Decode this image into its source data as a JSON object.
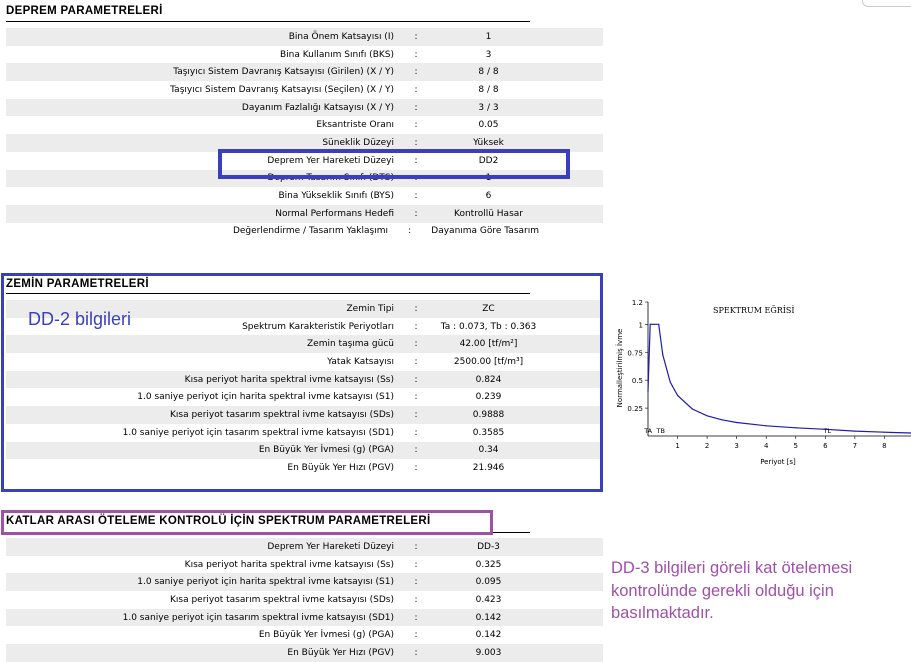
{
  "deprem": {
    "title": "DEPREM PARAMETRELERİ",
    "rows": [
      {
        "label": "Bina Önem Katsayısı (I)",
        "sep": ":",
        "value": "1"
      },
      {
        "label": "Bina Kullanım Sınıfı (BKS)",
        "sep": ":",
        "value": "3"
      },
      {
        "label": "Taşıyıcı Sistem Davranış Katsayısı (Girilen) (X / Y)",
        "sep": ":",
        "value": "8 / 8"
      },
      {
        "label": "Taşıyıcı Sistem Davranış Katsayısı (Seçilen) (X / Y)",
        "sep": ":",
        "value": "8 / 8"
      },
      {
        "label": "Dayanım Fazlalığı Katsayısı (X / Y)",
        "sep": ":",
        "value": "3 / 3"
      },
      {
        "label": "Eksantriste Oranı",
        "sep": ":",
        "value": "0.05"
      },
      {
        "label": "Süneklik Düzeyi",
        "sep": ":",
        "value": "Yüksek"
      },
      {
        "label": "Deprem Yer Hareketi Düzeyi",
        "sep": ":",
        "value": "DD2"
      },
      {
        "label": "Deprem Tasarım Sınıfı (DTS)",
        "sep": ":",
        "value": "1"
      },
      {
        "label": "Bina Yükseklik Sınıfı (BYS)",
        "sep": ":",
        "value": "6"
      },
      {
        "label": "Normal Performans Hedefi",
        "sep": ":",
        "value": "Kontrollü Hasar"
      },
      {
        "label": "Değerlendirme / Tasarım Yaklaşımı",
        "sep": ":",
        "value": "Dayanıma Göre Tasarım"
      }
    ]
  },
  "zemin": {
    "title": "ZEMİN PARAMETRELERİ",
    "rows": [
      {
        "label": "Zemin Tipi",
        "sep": ":",
        "value": "ZC"
      },
      {
        "label": "Spektrum Karakteristik Periyotları",
        "sep": ":",
        "value": "Ta : 0.073, Tb : 0.363"
      },
      {
        "label": "Zemin taşıma gücü",
        "sep": ":",
        "value": "42.00 [tf/m²]"
      },
      {
        "label": "Yatak Katsayısı",
        "sep": ":",
        "value": "2500.00 [tf/m³]"
      },
      {
        "label": "Kısa periyot harita spektral ivme katsayısı (Ss)",
        "sep": ":",
        "value": "0.824"
      },
      {
        "label": "1.0 saniye periyot için harita spektral ivme katsayısı (S1)",
        "sep": ":",
        "value": "0.239"
      },
      {
        "label": "Kısa periyot tasarım spektral ivme katsayısı (SDs)",
        "sep": ":",
        "value": "0.9888"
      },
      {
        "label": "1.0 saniye periyot için tasarım spektral ivme katsayısı (SD1)",
        "sep": ":",
        "value": "0.3585"
      },
      {
        "label": "En Büyük Yer İvmesi (g) (PGA)",
        "sep": ":",
        "value": "0.34"
      },
      {
        "label": "En Büyük Yer Hızı (PGV)",
        "sep": ":",
        "value": "21.946"
      }
    ]
  },
  "katlar": {
    "title": "KATLAR ARASI ÖTELEME KONTROLÜ İÇİN SPEKTRUM PARAMETRELERİ",
    "rows": [
      {
        "label": "Deprem Yer Hareketi Düzeyi",
        "sep": ":",
        "value": "DD-3"
      },
      {
        "label": "Kısa periyot harita spektral ivme katsayısı (Ss)",
        "sep": ":",
        "value": "0.325"
      },
      {
        "label": "1.0 saniye periyot için harita spektral ivme katsayısı (S1)",
        "sep": ":",
        "value": "0.095"
      },
      {
        "label": "Kısa periyot tasarım spektral ivme katsayısı (SDs)",
        "sep": ":",
        "value": "0.423"
      },
      {
        "label": "1.0 saniye periyot için tasarım spektral ivme katsayısı (SD1)",
        "sep": ":",
        "value": "0.142"
      },
      {
        "label": "En Büyük Yer İvmesi (g) (PGA)",
        "sep": ":",
        "value": "0.142"
      },
      {
        "label": "En Büyük Yer Hızı (PGV)",
        "sep": ":",
        "value": "9.003"
      }
    ]
  },
  "annotations": {
    "dd2_text": "DD-2 bilgileri",
    "dd3_lines": [
      "DD-3 bilgileri göreli kat ötelemesi",
      "kontrolünde gerekli olduğu için",
      "basılmaktadır."
    ],
    "highlight_color": "#3a3fc0",
    "dd3_color": "#a050a8"
  },
  "chart_data": {
    "type": "line",
    "title": "SPEKTRUM EĞRİSİ",
    "xlabel": "Periyot [s]",
    "ylabel": "Normalleştirilmiş İvme",
    "xlim": [
      0,
      8.9
    ],
    "ylim": [
      0,
      1.2
    ],
    "xticks": [
      "1",
      "2",
      "3",
      "4",
      "5",
      "6",
      "7",
      "8"
    ],
    "yticks": [
      "0.25",
      "0.5",
      "0.75",
      "1",
      "1.2"
    ],
    "markers": [
      {
        "label": "TA",
        "x": 0.073
      },
      {
        "label": "TB",
        "x": 0.363
      },
      {
        "label": "TL",
        "x": 6
      }
    ],
    "series": [
      {
        "x": [
          0,
          0.073,
          0.1,
          0.2,
          0.363,
          0.5,
          0.75,
          1,
          1.5,
          2,
          2.5,
          3,
          4,
          5,
          6,
          7,
          8,
          8.9
        ],
        "values": [
          0.4,
          1.0,
          1.0,
          1.0,
          1.0,
          0.726,
          0.484,
          0.363,
          0.242,
          0.181,
          0.145,
          0.121,
          0.091,
          0.073,
          0.06,
          0.044,
          0.034,
          0.027
        ]
      }
    ]
  }
}
